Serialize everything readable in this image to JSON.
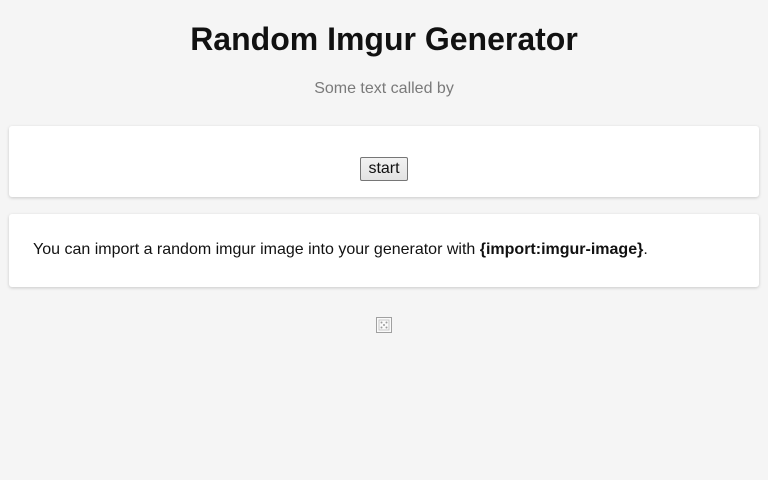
{
  "header": {
    "title": "Random Imgur Generator",
    "subtitle": "Some text called by"
  },
  "controls": {
    "start_label": "start"
  },
  "info": {
    "prefix": "You can import a random imgur image into your generator with ",
    "code": "{import:imgur-image}",
    "suffix": "."
  },
  "output": {
    "image_icon": "broken-image-icon"
  },
  "colors": {
    "background": "#f5f5f5",
    "card": "#ffffff",
    "subtitle": "#7a7a7a"
  }
}
